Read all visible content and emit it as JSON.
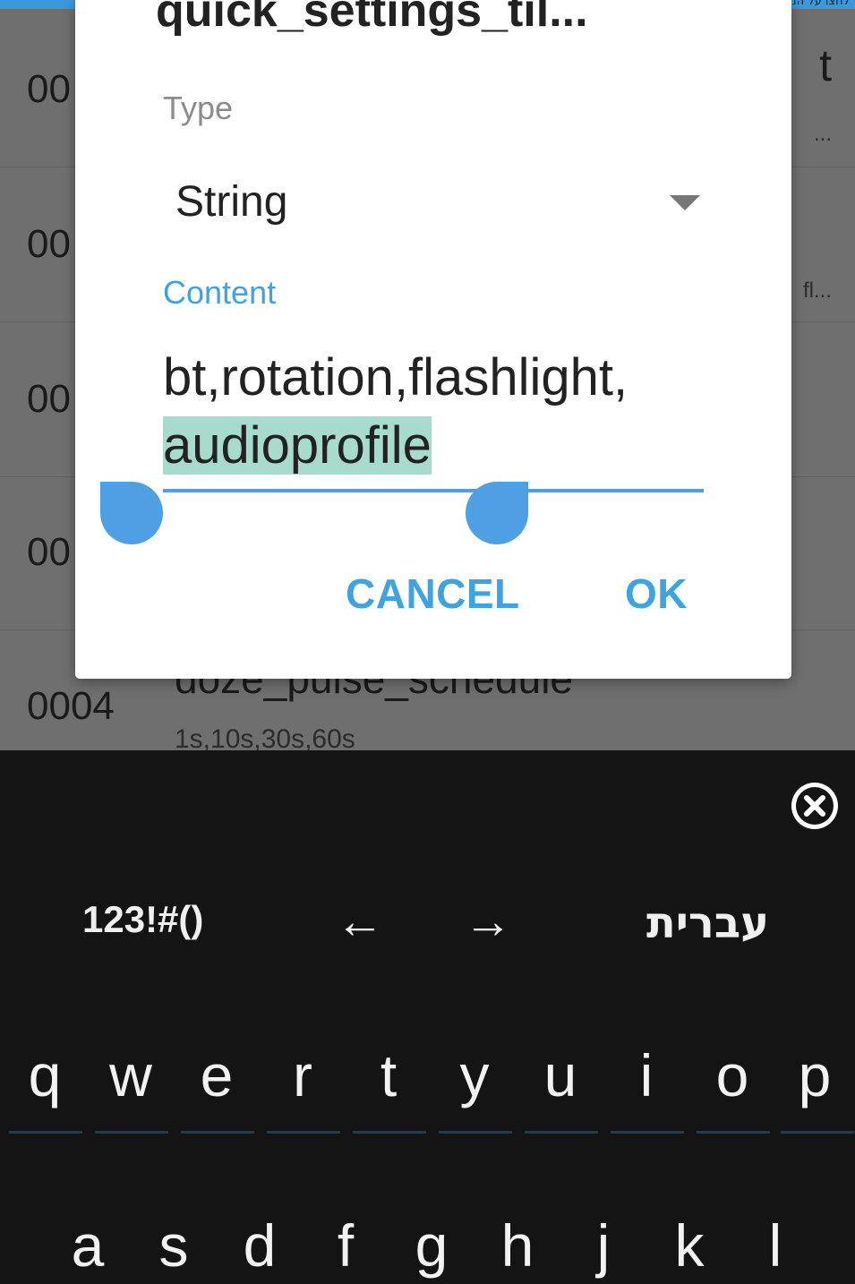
{
  "top_strip_text": "לחצו על המקשים לכתיבה (אנגלית)",
  "list_rows": [
    {
      "number": "00",
      "right_text": "t",
      "right_sub": "..."
    },
    {
      "number": "00",
      "right_text": "",
      "right_sub": "fl..."
    },
    {
      "number": "00",
      "right_text": "",
      "right_sub": ""
    },
    {
      "number": "00",
      "right_text": "",
      "right_sub": ""
    },
    {
      "number": "0004",
      "key": "doze_pulse_schedule",
      "value": "1s,10s,30s,60s"
    }
  ],
  "dialog": {
    "title": "quick_settings_til...",
    "type_label": "Type",
    "type_value": "String",
    "content_label": "Content",
    "content_text": "bt,rotation,flashlight,",
    "content_selected": "audioprofile",
    "cancel_label": "CANCEL",
    "ok_label": "OK"
  },
  "keyboard": {
    "symbols_label": "123!#()",
    "left_arrow": "←",
    "right_arrow": "→",
    "language_label": "עברית",
    "row1": [
      "q",
      "w",
      "e",
      "r",
      "t",
      "y",
      "u",
      "i",
      "o",
      "p"
    ],
    "row2": [
      "a",
      "s",
      "d",
      "f",
      "g",
      "h",
      "j",
      "k",
      "l"
    ]
  },
  "colors": {
    "accent": "#3fa3e0",
    "selection": "#a6dbcd",
    "dim_overlay": "#6f6f6f",
    "keyboard_bg": "#141414"
  }
}
